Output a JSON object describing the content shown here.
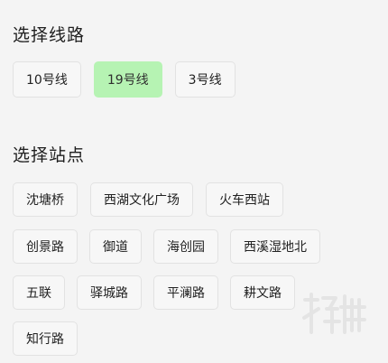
{
  "line_section": {
    "title": "选择线路",
    "lines": [
      {
        "label": "10号线",
        "selected": false
      },
      {
        "label": "19号线",
        "selected": true
      },
      {
        "label": "3号线",
        "selected": false
      }
    ]
  },
  "station_section": {
    "title": "选择站点",
    "rows": [
      [
        "沈塘桥",
        "西湖文化广场",
        "火车西站"
      ],
      [
        "创景路",
        "御道",
        "海创园",
        "西溪湿地北"
      ],
      [
        "五联",
        "驿城路",
        "平澜路",
        "耕文路"
      ],
      [
        "知行路"
      ]
    ]
  },
  "colors": {
    "selected_chip": "#b6f3b3",
    "chip_bg": "#f7f7f7",
    "page_bg": "#f4f4f4"
  }
}
